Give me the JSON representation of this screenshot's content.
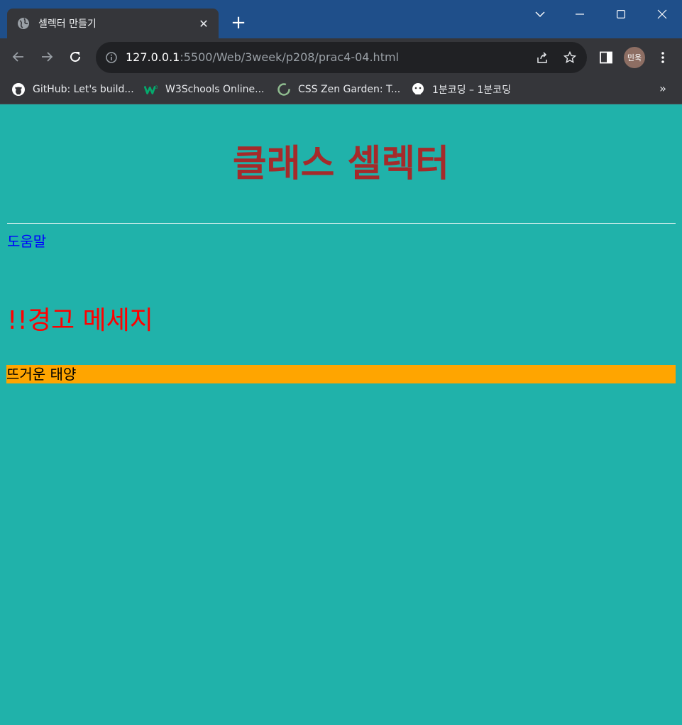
{
  "browser": {
    "tab_title": "셀렉터 만들기",
    "new_tab_symbol": "+",
    "url_host": "127.0.0.1",
    "url_rest": ":5500/Web/3week/p208/prac4-04.html",
    "profile_label": "민욱",
    "bookmarks": [
      {
        "label": "GitHub: Let's build...",
        "icon": "github-icon"
      },
      {
        "label": "W3Schools Online...",
        "icon": "w3schools-icon"
      },
      {
        "label": "CSS Zen Garden: T...",
        "icon": "zen-garden-icon"
      },
      {
        "label": "1분코딩 – 1분코딩",
        "icon": "coding-mascot-icon"
      }
    ],
    "bookmarks_more": "»"
  },
  "page": {
    "heading": "클래스 셀렉터",
    "help_text": "도움말",
    "warning_text": "!!경고 메세지",
    "sun_text": "뜨거운 태양",
    "colors": {
      "background": "#20b2aa",
      "heading": "#a52a2a",
      "help": "#0000ff",
      "warning": "#ff0000",
      "sun_background": "#ffa500"
    }
  }
}
